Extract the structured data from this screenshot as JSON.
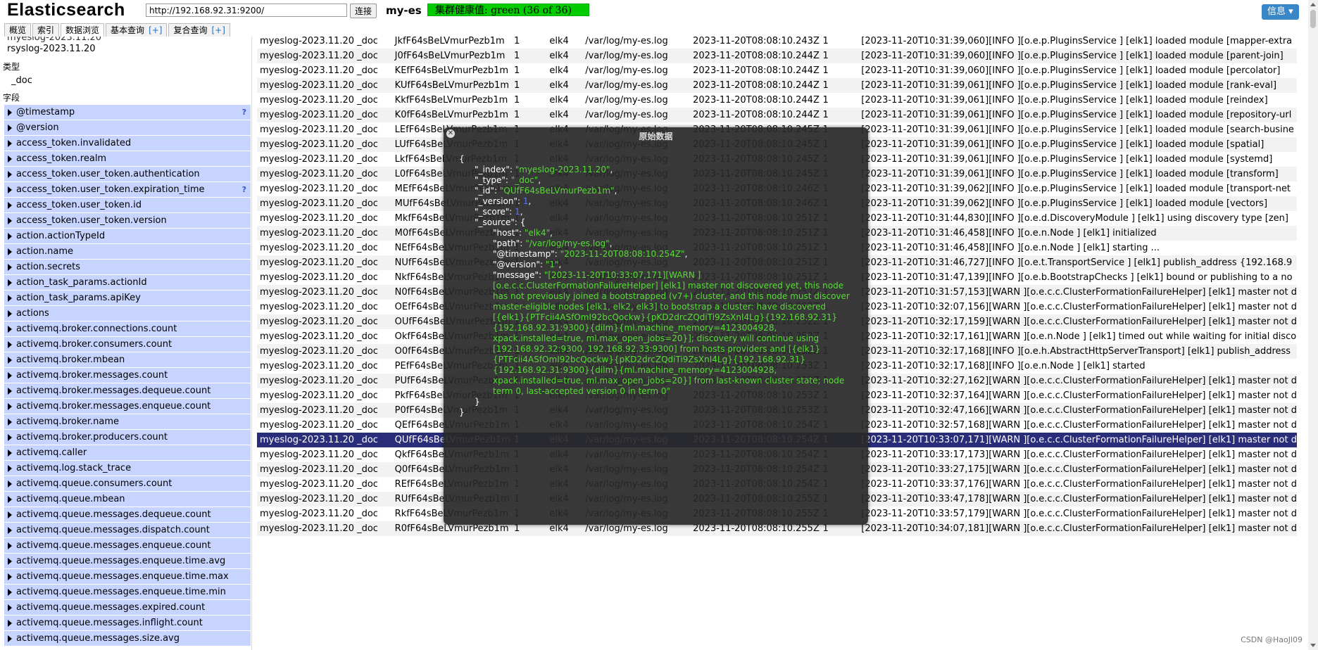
{
  "header": {
    "app_title": "Elasticsearch",
    "url_value": "http://192.168.92.31:9200/",
    "connect_label": "连接",
    "cluster_name": "my-es",
    "cluster_health": "集群健康值: green (36 of 36)",
    "info_label": "信息 ▾"
  },
  "tabs": [
    {
      "label": "概览",
      "plus": ""
    },
    {
      "label": "索引",
      "plus": ""
    },
    {
      "label": "数据浏览",
      "plus": ""
    },
    {
      "label": "基本查询",
      "plus": "[+]"
    },
    {
      "label": "复合查询",
      "plus": "[+]"
    }
  ],
  "sidebar": {
    "partial_top": "myeslog-2023.11.20",
    "index_value": "rsyslog-2023.11.20",
    "type_label": "类型",
    "type_value": "_doc",
    "fields_label": "字段",
    "fields": [
      {
        "name": "@timestamp",
        "q": "?"
      },
      {
        "name": "@version",
        "q": ""
      },
      {
        "name": "access_token.invalidated",
        "q": ""
      },
      {
        "name": "access_token.realm",
        "q": ""
      },
      {
        "name": "access_token.user_token.authentication",
        "q": ""
      },
      {
        "name": "access_token.user_token.expiration_time",
        "q": "?"
      },
      {
        "name": "access_token.user_token.id",
        "q": ""
      },
      {
        "name": "access_token.user_token.version",
        "q": ""
      },
      {
        "name": "action.actionTypeId",
        "q": ""
      },
      {
        "name": "action.name",
        "q": ""
      },
      {
        "name": "action.secrets",
        "q": ""
      },
      {
        "name": "action_task_params.actionId",
        "q": ""
      },
      {
        "name": "action_task_params.apiKey",
        "q": ""
      },
      {
        "name": "actions",
        "q": ""
      },
      {
        "name": "activemq.broker.connections.count",
        "q": ""
      },
      {
        "name": "activemq.broker.consumers.count",
        "q": ""
      },
      {
        "name": "activemq.broker.mbean",
        "q": ""
      },
      {
        "name": "activemq.broker.messages.count",
        "q": ""
      },
      {
        "name": "activemq.broker.messages.dequeue.count",
        "q": ""
      },
      {
        "name": "activemq.broker.messages.enqueue.count",
        "q": ""
      },
      {
        "name": "activemq.broker.name",
        "q": ""
      },
      {
        "name": "activemq.broker.producers.count",
        "q": ""
      },
      {
        "name": "activemq.caller",
        "q": ""
      },
      {
        "name": "activemq.log.stack_trace",
        "q": ""
      },
      {
        "name": "activemq.queue.consumers.count",
        "q": ""
      },
      {
        "name": "activemq.queue.mbean",
        "q": ""
      },
      {
        "name": "activemq.queue.messages.dequeue.count",
        "q": ""
      },
      {
        "name": "activemq.queue.messages.dispatch.count",
        "q": ""
      },
      {
        "name": "activemq.queue.messages.enqueue.count",
        "q": ""
      },
      {
        "name": "activemq.queue.messages.enqueue.time.avg",
        "q": ""
      },
      {
        "name": "activemq.queue.messages.enqueue.time.max",
        "q": ""
      },
      {
        "name": "activemq.queue.messages.enqueue.time.min",
        "q": ""
      },
      {
        "name": "activemq.queue.messages.expired.count",
        "q": ""
      },
      {
        "name": "activemq.queue.messages.inflight.count",
        "q": ""
      },
      {
        "name": "activemq.queue.messages.size.avg",
        "q": ""
      }
    ]
  },
  "table": {
    "rows": [
      [
        "myeslog-2023.11.20",
        "_doc",
        "JkfF64sBeLVmurPezb1m",
        "1",
        "elk4",
        "/var/log/my-es.log",
        "2023-11-20T08:08:10.243Z",
        "1",
        "[2023-11-20T10:31:39,060][INFO ][o.e.p.PluginsService ] [elk1] loaded module [mapper-extra"
      ],
      [
        "myeslog-2023.11.20",
        "_doc",
        "J0fF64sBeLVmurPezb1m",
        "1",
        "elk4",
        "/var/log/my-es.log",
        "2023-11-20T08:08:10.244Z",
        "1",
        "[2023-11-20T10:31:39,060][INFO ][o.e.p.PluginsService ] [elk1] loaded module [parent-join]"
      ],
      [
        "myeslog-2023.11.20",
        "_doc",
        "KEfF64sBeLVmurPezb1m",
        "1",
        "elk4",
        "/var/log/my-es.log",
        "2023-11-20T08:08:10.244Z",
        "1",
        "[2023-11-20T10:31:39,060][INFO ][o.e.p.PluginsService ] [elk1] loaded module [percolator]"
      ],
      [
        "myeslog-2023.11.20",
        "_doc",
        "KUfF64sBeLVmurPezb1m",
        "1",
        "elk4",
        "/var/log/my-es.log",
        "2023-11-20T08:08:10.244Z",
        "1",
        "[2023-11-20T10:31:39,061][INFO ][o.e.p.PluginsService ] [elk1] loaded module [rank-eval]"
      ],
      [
        "myeslog-2023.11.20",
        "_doc",
        "KkfF64sBeLVmurPezb1m",
        "1",
        "elk4",
        "/var/log/my-es.log",
        "2023-11-20T08:08:10.244Z",
        "1",
        "[2023-11-20T10:31:39,061][INFO ][o.e.p.PluginsService ] [elk1] loaded module [reindex]"
      ],
      [
        "myeslog-2023.11.20",
        "_doc",
        "K0fF64sBeLVmurPezb1m",
        "1",
        "elk4",
        "/var/log/my-es.log",
        "2023-11-20T08:08:10.244Z",
        "1",
        "[2023-11-20T10:31:39,061][INFO ][o.e.p.PluginsService ] [elk1] loaded module [repository-url"
      ],
      [
        "myeslog-2023.11.20",
        "_doc",
        "LEfF64sBeLVmurPezb1m",
        "1",
        "elk4",
        "/var/log/my-es.log",
        "2023-11-20T08:08:10.245Z",
        "1",
        "[2023-11-20T10:31:39,061][INFO ][o.e.p.PluginsService ] [elk1] loaded module [search-busine"
      ],
      [
        "myeslog-2023.11.20",
        "_doc",
        "LUfF64sBeLVmurPezb1m",
        "1",
        "elk4",
        "/var/log/my-es.log",
        "2023-11-20T08:08:10.245Z",
        "1",
        "[2023-11-20T10:31:39,061][INFO ][o.e.p.PluginsService ] [elk1] loaded module [spatial]"
      ],
      [
        "myeslog-2023.11.20",
        "_doc",
        "LkfF64sBeLVmurPezb1m",
        "1",
        "elk4",
        "/var/log/my-es.log",
        "2023-11-20T08:08:10.245Z",
        "1",
        "[2023-11-20T10:31:39,061][INFO ][o.e.p.PluginsService ] [elk1] loaded module [systemd]"
      ],
      [
        "myeslog-2023.11.20",
        "_doc",
        "L0fF64sBeLVmurPezb1m",
        "1",
        "elk4",
        "/var/log/my-es.log",
        "2023-11-20T08:08:10.245Z",
        "1",
        "[2023-11-20T10:31:39,061][INFO ][o.e.p.PluginsService ] [elk1] loaded module [transform]"
      ],
      [
        "myeslog-2023.11.20",
        "_doc",
        "MEfF64sBeLVmurPezb1m",
        "1",
        "elk4",
        "/var/log/my-es.log",
        "2023-11-20T08:08:10.246Z",
        "1",
        "[2023-11-20T10:31:39,062][INFO ][o.e.p.PluginsService ] [elk1] loaded module [transport-net"
      ],
      [
        "myeslog-2023.11.20",
        "_doc",
        "MUfF64sBeLVmurPezb1m",
        "1",
        "elk4",
        "/var/log/my-es.log",
        "2023-11-20T08:08:10.246Z",
        "1",
        "[2023-11-20T10:31:39,062][INFO ][o.e.p.PluginsService ] [elk1] loaded module [vectors]"
      ],
      [
        "myeslog-2023.11.20",
        "_doc",
        "MkfF64sBeLVmurPezb1m",
        "1",
        "elk4",
        "/var/log/my-es.log",
        "2023-11-20T08:08:10.251Z",
        "1",
        "[2023-11-20T10:31:44,830][INFO ][o.e.d.DiscoveryModule ] [elk1] using discovery type [zen]"
      ],
      [
        "myeslog-2023.11.20",
        "_doc",
        "M0fF64sBeLVmurPezb1m",
        "1",
        "elk4",
        "/var/log/my-es.log",
        "2023-11-20T08:08:10.251Z",
        "1",
        "[2023-11-20T10:31:46,458][INFO ][o.e.n.Node ] [elk1] initialized"
      ],
      [
        "myeslog-2023.11.20",
        "_doc",
        "NEfF64sBeLVmurPezb1m",
        "1",
        "elk4",
        "/var/log/my-es.log",
        "2023-11-20T08:08:10.251Z",
        "1",
        "[2023-11-20T10:31:46,458][INFO ][o.e.n.Node ] [elk1] starting ..."
      ],
      [
        "myeslog-2023.11.20",
        "_doc",
        "NUfF64sBeLVmurPezb1m",
        "1",
        "elk4",
        "/var/log/my-es.log",
        "2023-11-20T08:08:10.251Z",
        "1",
        "[2023-11-20T10:31:46,727][INFO ][o.e.t.TransportService ] [elk1] publish_address {192.168.9"
      ],
      [
        "myeslog-2023.11.20",
        "_doc",
        "NkfF64sBeLVmurPezb1m",
        "1",
        "elk4",
        "/var/log/my-es.log",
        "2023-11-20T08:08:10.251Z",
        "1",
        "[2023-11-20T10:31:47,139][INFO ][o.e.b.BootstrapChecks ] [elk1] bound or publishing to a no"
      ],
      [
        "myeslog-2023.11.20",
        "_doc",
        "N0fF64sBeLVmurPezb1m",
        "1",
        "elk4",
        "/var/log/my-es.log",
        "2023-11-20T08:08:10.252Z",
        "1",
        "[2023-11-20T10:31:57,153][WARN ][o.e.c.c.ClusterFormationFailureHelper] [elk1] master not d"
      ],
      [
        "myeslog-2023.11.20",
        "_doc",
        "OEfF64sBeLVmurPezb1m",
        "1",
        "elk4",
        "/var/log/my-es.log",
        "2023-11-20T08:08:10.252Z",
        "1",
        "[2023-11-20T10:32:07,156][WARN ][o.e.c.c.ClusterFormationFailureHelper] [elk1] master not d"
      ],
      [
        "myeslog-2023.11.20",
        "_doc",
        "OUfF64sBeLVmurPezb1m",
        "1",
        "elk4",
        "/var/log/my-es.log",
        "2023-11-20T08:08:10.252Z",
        "1",
        "[2023-11-20T10:32:17,159][WARN ][o.e.c.c.ClusterFormationFailureHelper] [elk1] master not d"
      ],
      [
        "myeslog-2023.11.20",
        "_doc",
        "OkfF64sBeLVmurPezb1m",
        "1",
        "elk4",
        "/var/log/my-es.log",
        "2023-11-20T08:08:10.252Z",
        "1",
        "[2023-11-20T10:32:17,161][WARN ][o.e.n.Node ] [elk1] timed out while waiting for initial disco"
      ],
      [
        "myeslog-2023.11.20",
        "_doc",
        "O0fF64sBeLVmurPezb1m",
        "1",
        "elk4",
        "/var/log/my-es.log",
        "2023-11-20T08:08:10.252Z",
        "1",
        "[2023-11-20T10:32:17,168][INFO ][o.e.h.AbstractHttpServerTransport] [elk1] publish_address"
      ],
      [
        "myeslog-2023.11.20",
        "_doc",
        "PEfF64sBeLVmurPezb1m",
        "1",
        "elk4",
        "/var/log/my-es.log",
        "2023-11-20T08:08:10.253Z",
        "1",
        "[2023-11-20T10:32:17,168][INFO ][o.e.n.Node ] [elk1] started"
      ],
      [
        "myeslog-2023.11.20",
        "_doc",
        "PUfF64sBeLVmurPezb1m",
        "1",
        "elk4",
        "/var/log/my-es.log",
        "2023-11-20T08:08:10.253Z",
        "1",
        "[2023-11-20T10:32:27,162][WARN ][o.e.c.c.ClusterFormationFailureHelper] [elk1] master not d"
      ],
      [
        "myeslog-2023.11.20",
        "_doc",
        "PkfF64sBeLVmurPezb1m",
        "1",
        "elk4",
        "/var/log/my-es.log",
        "2023-11-20T08:08:10.253Z",
        "1",
        "[2023-11-20T10:32:37,164][WARN ][o.e.c.c.ClusterFormationFailureHelper] [elk1] master not d"
      ],
      [
        "myeslog-2023.11.20",
        "_doc",
        "P0fF64sBeLVmurPezb1m",
        "1",
        "elk4",
        "/var/log/my-es.log",
        "2023-11-20T08:08:10.253Z",
        "1",
        "[2023-11-20T10:32:47,166][WARN ][o.e.c.c.ClusterFormationFailureHelper] [elk1] master not d"
      ],
      [
        "myeslog-2023.11.20",
        "_doc",
        "QEfF64sBeLVmurPezb1m",
        "1",
        "elk4",
        "/var/log/my-es.log",
        "2023-11-20T08:08:10.254Z",
        "1",
        "[2023-11-20T10:32:57,168][WARN ][o.e.c.c.ClusterFormationFailureHelper] [elk1] master not d"
      ],
      [
        "myeslog-2023.11.20",
        "_doc",
        "QUfF64sBeLVmurPezb1m",
        "1",
        "elk4",
        "/var/log/my-es.log",
        "2023-11-20T08:08:10.254Z",
        "1",
        "[2023-11-20T10:33:07,171][WARN ][o.e.c.c.ClusterFormationFailureHelper] [elk1] master not d"
      ],
      [
        "myeslog-2023.11.20",
        "_doc",
        "QkfF64sBeLVmurPezb1m",
        "1",
        "elk4",
        "/var/log/my-es.log",
        "2023-11-20T08:08:10.254Z",
        "1",
        "[2023-11-20T10:33:17,173][WARN ][o.e.c.c.ClusterFormationFailureHelper] [elk1] master not d"
      ],
      [
        "myeslog-2023.11.20",
        "_doc",
        "Q0fF64sBeLVmurPezb1m",
        "1",
        "elk4",
        "/var/log/my-es.log",
        "2023-11-20T08:08:10.254Z",
        "1",
        "[2023-11-20T10:33:27,175][WARN ][o.e.c.c.ClusterFormationFailureHelper] [elk1] master not d"
      ],
      [
        "myeslog-2023.11.20",
        "_doc",
        "REfF64sBeLVmurPezb1m",
        "1",
        "elk4",
        "/var/log/my-es.log",
        "2023-11-20T08:08:10.254Z",
        "1",
        "[2023-11-20T10:33:37,176][WARN ][o.e.c.c.ClusterFormationFailureHelper] [elk1] master not d"
      ],
      [
        "myeslog-2023.11.20",
        "_doc",
        "RUfF64sBeLVmurPezb1m",
        "1",
        "elk4",
        "/var/log/my-es.log",
        "2023-11-20T08:08:10.255Z",
        "1",
        "[2023-11-20T10:33:47,178][WARN ][o.e.c.c.ClusterFormationFailureHelper] [elk1] master not d"
      ],
      [
        "myeslog-2023.11.20",
        "_doc",
        "RkfF64sBeLVmurPezb1m",
        "1",
        "elk4",
        "/var/log/my-es.log",
        "2023-11-20T08:08:10.255Z",
        "1",
        "[2023-11-20T10:33:57,179][WARN ][o.e.c.c.ClusterFormationFailureHelper] [elk1] master not d"
      ],
      [
        "myeslog-2023.11.20",
        "_doc",
        "R0fF64sBeLVmurPezb1m",
        "1",
        "elk4",
        "/var/log/my-es.log",
        "2023-11-20T08:08:10.255Z",
        "1",
        "[2023-11-20T10:34:07,181][WARN ][o.e.c.c.ClusterFormationFailureHelper] [elk1] master not d"
      ]
    ],
    "selected_index": 27
  },
  "modal": {
    "title": "原始数据",
    "close_icon": "close-icon",
    "open_brace": "{",
    "close_brace": "}",
    "source_open": "\"_source\": {",
    "source_close": "}",
    "fields": {
      "index_key": "\"_index\": ",
      "index_val": "\"myeslog-2023.11.20\"",
      "type_key": "\"_type\": ",
      "type_val": "\"_doc\"",
      "id_key": "\"_id\": ",
      "id_val": "\"QUfF64sBeLVmurPezb1m\"",
      "version_key": "\"_version\": ",
      "version_val": "1",
      "score_key": "\"_score\": ",
      "score_val": "1",
      "host_key": "\"host\": ",
      "host_val": "\"elk4\"",
      "path_key": "\"path\": ",
      "path_val": "\"/var/log/my-es.log\"",
      "ts_key": "\"@timestamp\": ",
      "ts_val": "\"2023-11-20T08:08:10.254Z\"",
      "ver_key": "\"@version\": ",
      "ver_val": "\"1\"",
      "msg_key": "\"message\": ",
      "msg_val": "\"[2023-11-20T10:33:07,171][WARN ][o.e.c.c.ClusterFormationFailureHelper] [elk1] master not discovered yet, this node has not previously joined a bootstrapped (v7+) cluster, and this node must discover master-eligible nodes [elk1, elk2, elk3] to bootstrap a cluster: have discovered [{elk1}{PTFcii4ASfOmI92bcQockw}{pKD2drcZQdiTi9ZsXnI4Lg}{192.168.92.31}{192.168.92.31:9300}{dilm}{ml.machine_memory=4123004928, xpack.installed=true, ml.max_open_jobs=20}]; discovery will continue using [192.168.92.32:9300, 192.168.92.33:9300] from hosts providers and [{elk1}{PTFcii4ASfOmI92bcQockw}{pKD2drcZQdiTi9ZsXnI4Lg}{192.168.92.31}{192.168.92.31:9300}{dilm}{ml.machine_memory=4123004928, xpack.installed=true, ml.max_open_jobs=20}] from last-known cluster state; node term 0, last-accepted version 0 in term 0\""
    }
  },
  "watermark": "CSDN @HaoJl09"
}
